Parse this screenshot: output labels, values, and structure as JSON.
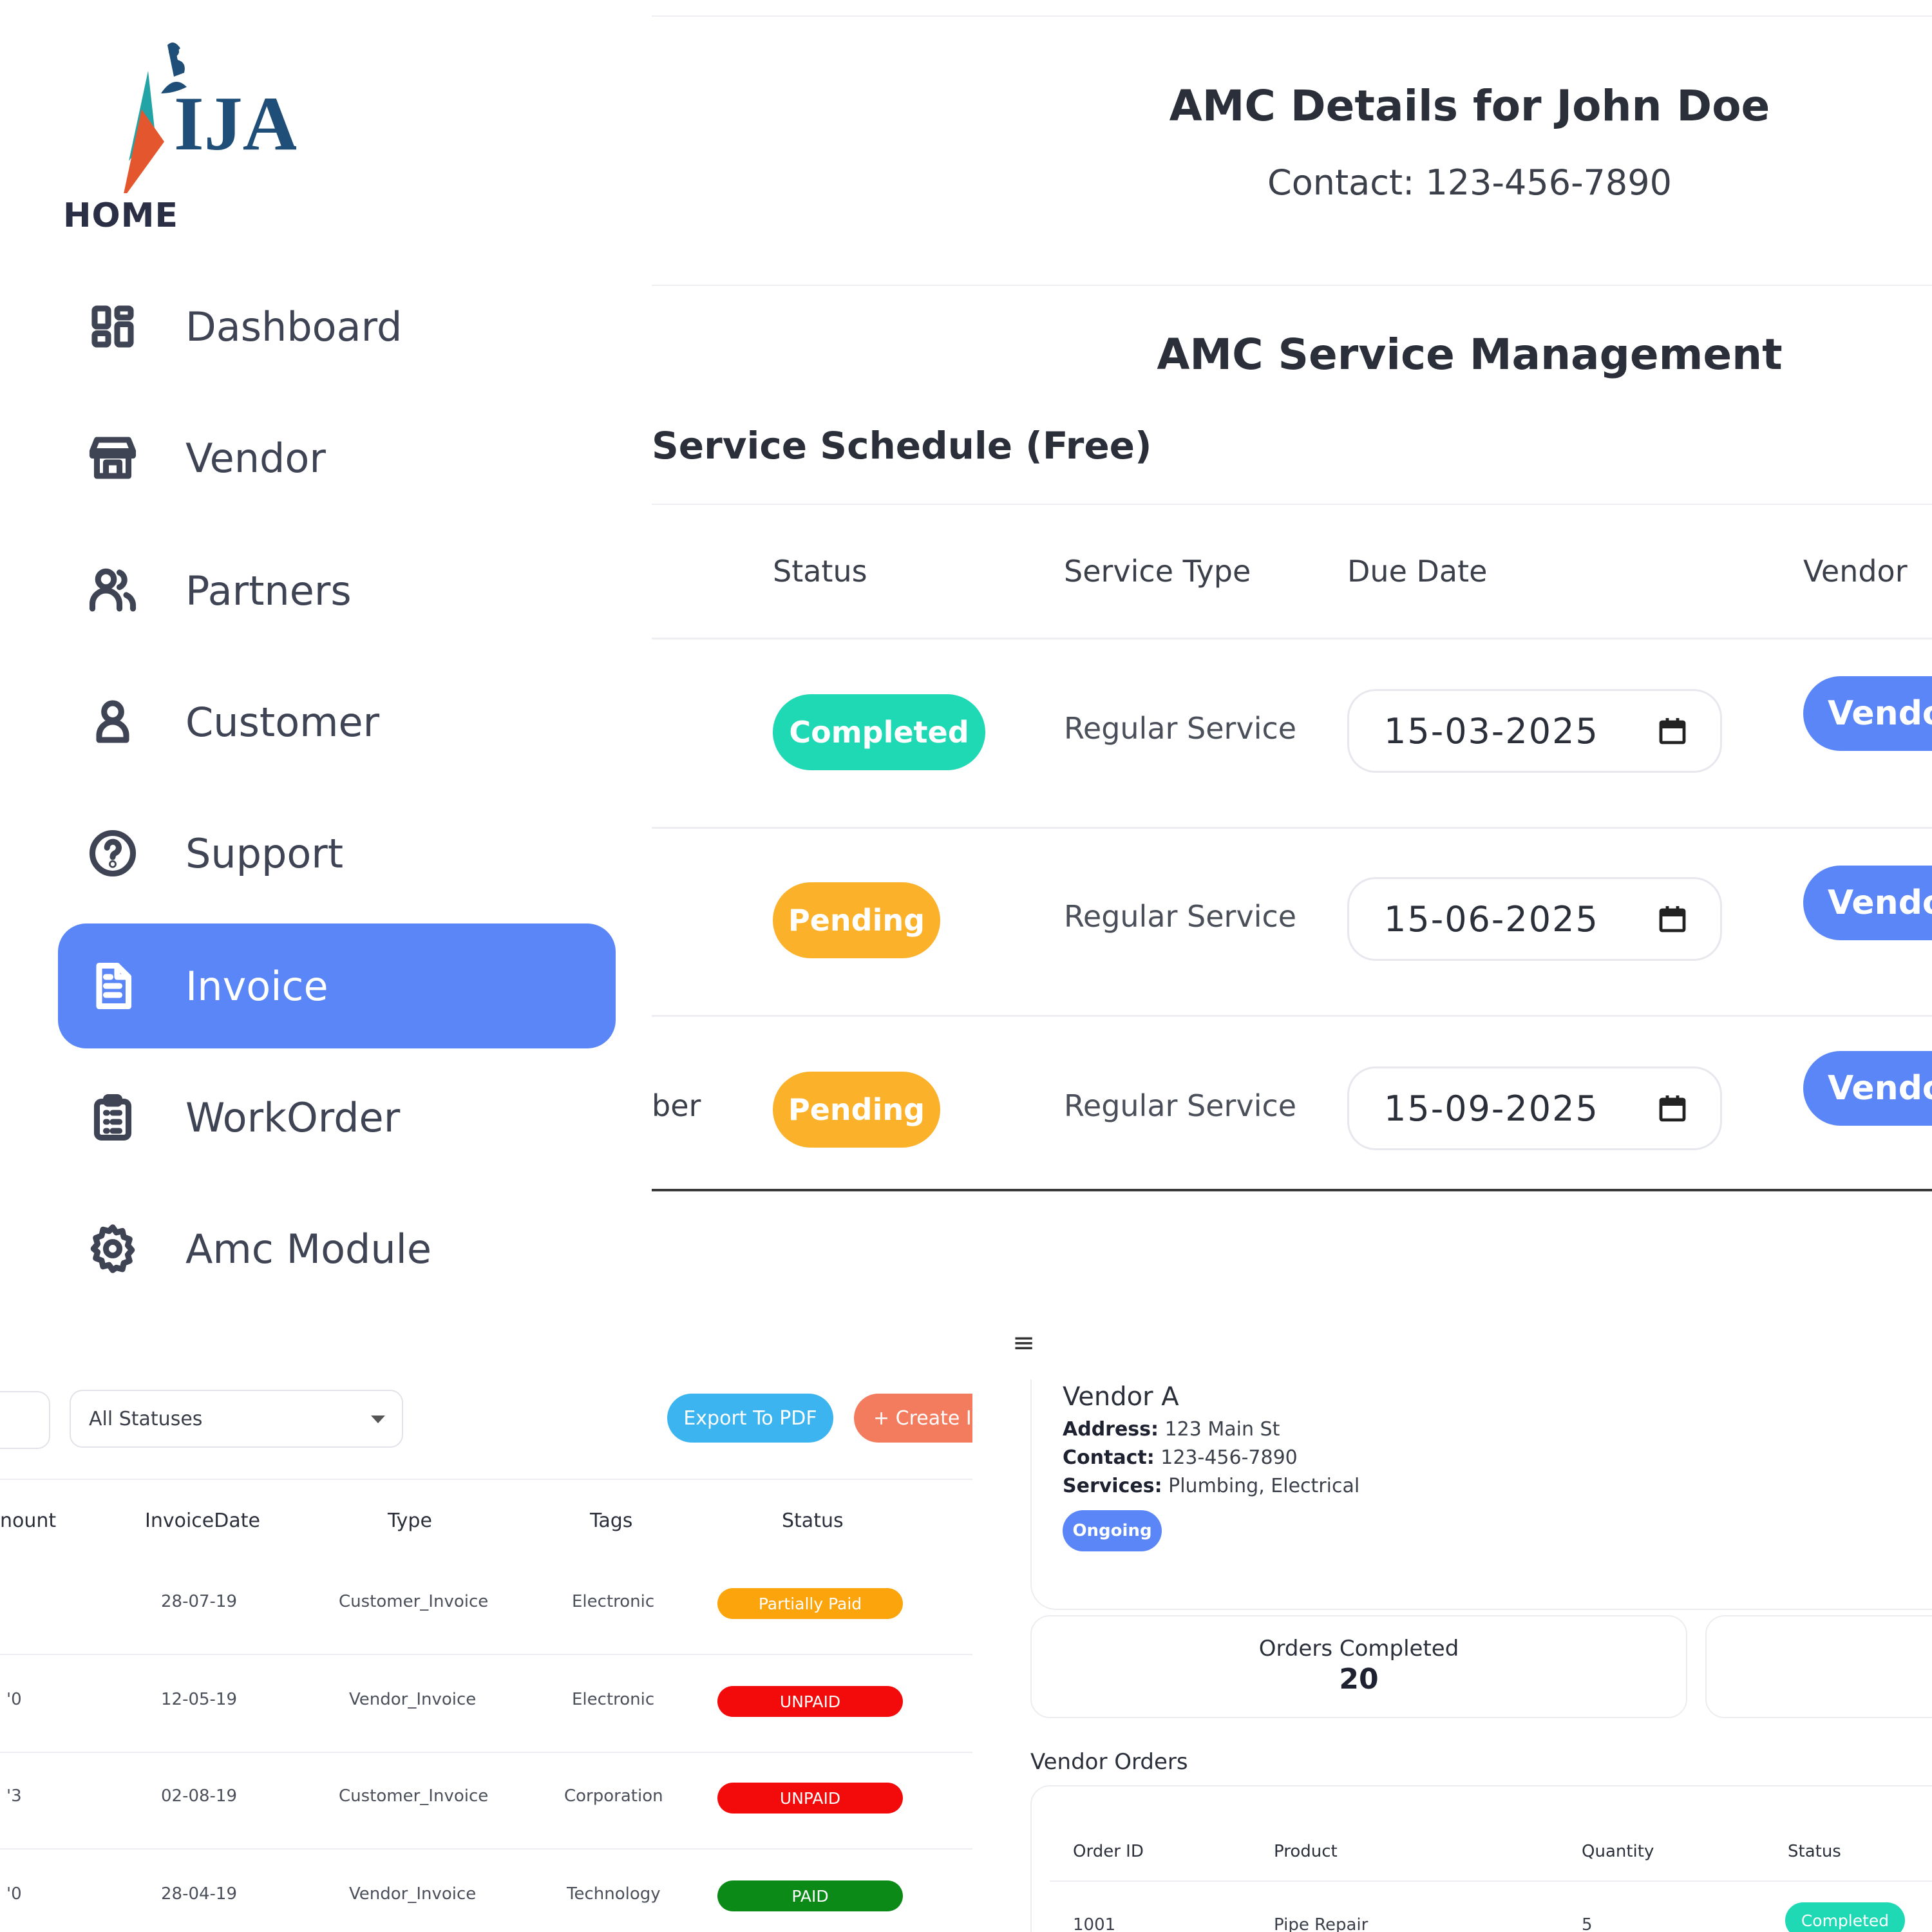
{
  "sidebar": {
    "logo_text": "IJAN",
    "home_label": "HOME",
    "items": [
      {
        "label": "Dashboard",
        "icon": "dashboard-icon"
      },
      {
        "label": "Vendor",
        "icon": "store-icon"
      },
      {
        "label": "Partners",
        "icon": "users-icon"
      },
      {
        "label": "Customer",
        "icon": "user-icon"
      },
      {
        "label": "Support",
        "icon": "help-circle-icon"
      },
      {
        "label": "Invoice",
        "icon": "document-icon",
        "active": true
      },
      {
        "label": "WorkOrder",
        "icon": "clipboard-icon"
      },
      {
        "label": "Amc Module",
        "icon": "gear-icon"
      }
    ]
  },
  "amc": {
    "title": "AMC Details for John Doe",
    "contact": "Contact: 123-456-7890",
    "subtitle": "AMC Service Management",
    "schedule_title": "Service Schedule (Free)",
    "columns": [
      "Status",
      "Service Type",
      "Due Date",
      "Vendor"
    ],
    "rows": [
      {
        "status": "Completed",
        "status_color": "#1ed9b4",
        "service_type": "Regular Service",
        "due_date": "15-03-2025",
        "vendor_btn": "Vendor",
        "left_text": ""
      },
      {
        "status": "Pending",
        "status_color": "#fbb12a",
        "service_type": "Regular Service",
        "due_date": "15-06-2025",
        "vendor_btn": "Vendor",
        "left_text": ""
      },
      {
        "status": "Pending",
        "status_color": "#fbb12a",
        "service_type": "Regular Service",
        "due_date": "15-09-2025",
        "vendor_btn": "Vendor",
        "left_text": "ber"
      }
    ]
  },
  "invoice": {
    "status_filter": "All Statuses",
    "export_label": "Export To PDF",
    "create_label": "+ Create In",
    "columns": [
      "nount",
      "InvoiceDate",
      "Type",
      "Tags",
      "Status"
    ],
    "rows": [
      {
        "amount": "",
        "date": "28-07-19",
        "type": "Customer_Invoice",
        "tags": "Electronic",
        "status": "Partially Paid",
        "status_color": "#fba40b"
      },
      {
        "amount": "'0",
        "date": "12-05-19",
        "type": "Vendor_Invoice",
        "tags": "Electronic",
        "status": "UNPAID",
        "status_color": "#f30a0a"
      },
      {
        "amount": "'3",
        "date": "02-08-19",
        "type": "Customer_Invoice",
        "tags": "Corporation",
        "status": "UNPAID",
        "status_color": "#f30a0a"
      },
      {
        "amount": "'0",
        "date": "28-04-19",
        "type": "Vendor_Invoice",
        "tags": "Technology",
        "status": "PAID",
        "status_color": "#0b8a17"
      }
    ]
  },
  "vendor": {
    "name": "Vendor A",
    "address_label": "Address:",
    "address": "123 Main St",
    "contact_label": "Contact:",
    "contact": "123-456-7890",
    "services_label": "Services:",
    "services": "Plumbing, Electrical",
    "status": "Ongoing",
    "orders_completed_label": "Orders Completed",
    "orders_completed_value": "20",
    "orders_title": "Vendor Orders",
    "order_columns": [
      "Order ID",
      "Product",
      "Quantity",
      "Status"
    ],
    "orders": [
      {
        "id": "1001",
        "product": "Pipe Repair",
        "quantity": "5",
        "status": "Completed"
      }
    ]
  },
  "colors": {
    "accent": "#5b86f7",
    "completed": "#1ed9b4",
    "pending": "#fbb12a"
  }
}
